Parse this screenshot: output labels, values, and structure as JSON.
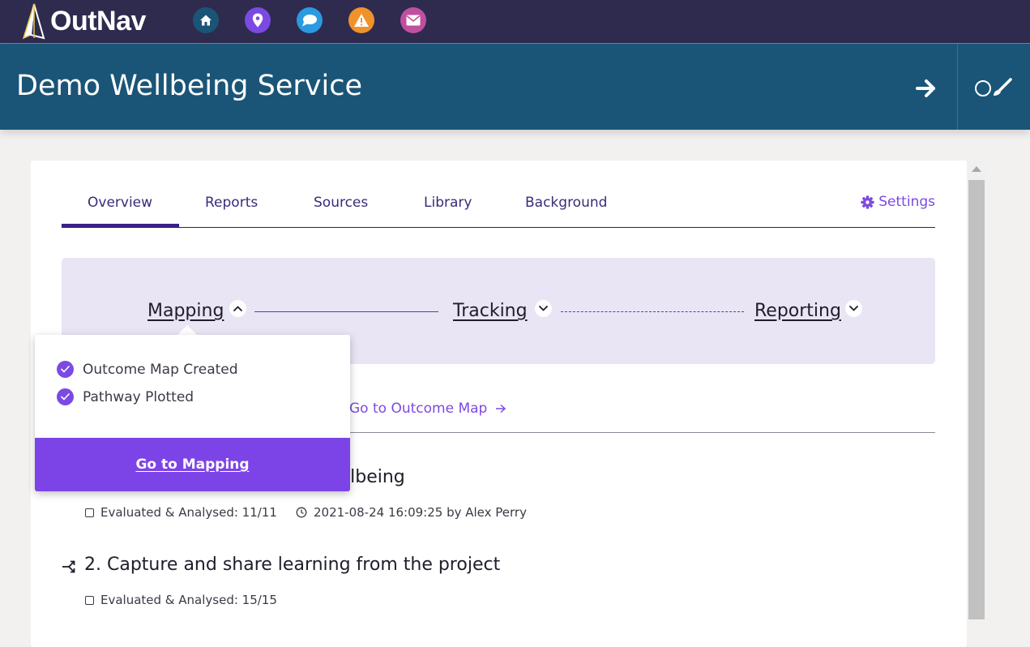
{
  "brand": {
    "name": "OutNav"
  },
  "topnav": {
    "icons": [
      {
        "name": "home-icon",
        "color": "#1a5577"
      },
      {
        "name": "map-pin-icon",
        "color": "#7b4ae2"
      },
      {
        "name": "chat-icon",
        "color": "#2b9ae0"
      },
      {
        "name": "warning-icon",
        "color": "#f0922b"
      },
      {
        "name": "mail-icon",
        "color": "#c04fa0"
      }
    ]
  },
  "header": {
    "title": "Demo Wellbeing Service"
  },
  "tabs": {
    "items": [
      "Overview",
      "Reports",
      "Sources",
      "Library",
      "Background"
    ],
    "active": "Overview",
    "settings_label": "Settings"
  },
  "stepper": {
    "steps": [
      {
        "label": "Mapping",
        "expanded": true
      },
      {
        "label": "Tracking",
        "expanded": false
      },
      {
        "label": "Reporting",
        "expanded": false
      }
    ]
  },
  "popover": {
    "checklist": [
      "Outcome Map Created",
      "Pathway Plotted"
    ],
    "button_label": "Go to Mapping"
  },
  "links": {
    "outcome_map": "Go to Outcome Map"
  },
  "outcomes": [
    {
      "title_visible": "llbeing",
      "evaluated": "Evaluated & Analysed: 11/11",
      "timestamp": "2021-08-24 16:09:25 by Alex Perry"
    },
    {
      "title": "2. Capture and share learning from the project",
      "evaluated": "Evaluated & Analysed: 15/15"
    }
  ],
  "colors": {
    "topbar": "#2e2b4f",
    "header": "#1a5577",
    "accent": "#7b4ae2",
    "button": "#7c44e6",
    "stepper_bg": "#e9e5f5"
  }
}
